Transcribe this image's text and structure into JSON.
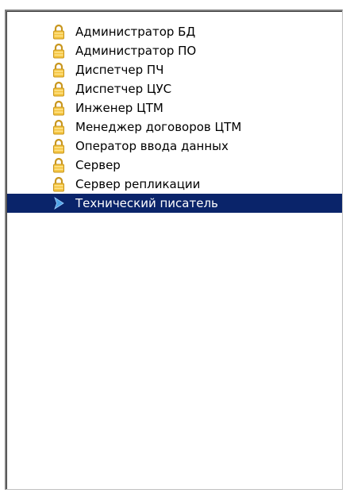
{
  "list": {
    "items": [
      {
        "label": "Администратор БД",
        "icon": "lock-icon"
      },
      {
        "label": "Администратор ПО",
        "icon": "lock-icon"
      },
      {
        "label": "Диспетчер ПЧ",
        "icon": "lock-icon"
      },
      {
        "label": "Диспетчер ЦУС",
        "icon": "lock-icon"
      },
      {
        "label": "Инженер ЦТМ",
        "icon": "lock-icon"
      },
      {
        "label": "Менеджер договоров ЦТМ",
        "icon": "lock-icon"
      },
      {
        "label": "Оператор ввода данных",
        "icon": "lock-icon"
      },
      {
        "label": "Сервер",
        "icon": "lock-icon"
      },
      {
        "label": "Сервер репликации",
        "icon": "lock-icon"
      },
      {
        "label": "Технический писатель",
        "icon": "play-arrow-icon"
      }
    ],
    "selected_index": 9
  },
  "colors": {
    "selection_background": "#0a246a",
    "selection_text": "#ffffff",
    "lock_body": "#f4c542",
    "lock_shackle": "#c8961e",
    "arrow": "#4fa3e6"
  }
}
